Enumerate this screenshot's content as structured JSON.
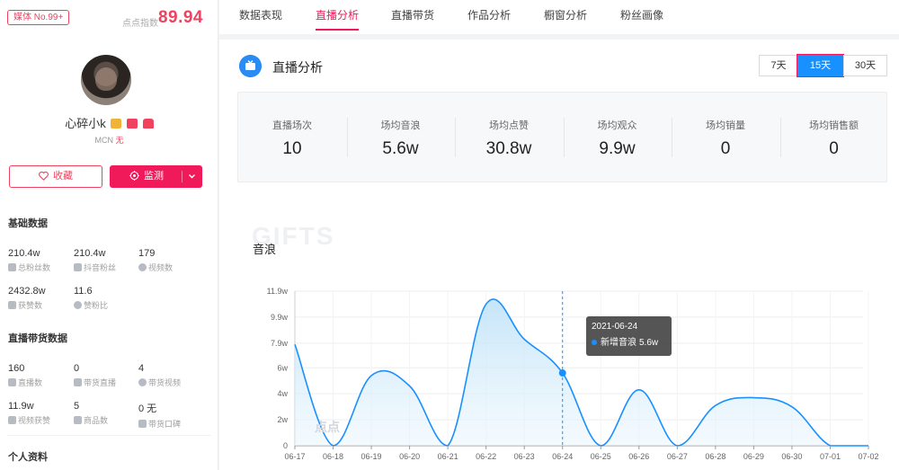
{
  "profile": {
    "badge": "媒体 No.99+",
    "score_label": "点点指数",
    "score": "89.94",
    "name": "心碎小k",
    "mcn_label": "MCN",
    "mcn_value": "无",
    "fav_label": "收藏",
    "monitor_label": "监测"
  },
  "basic": {
    "title": "基础数据",
    "stats": [
      {
        "value": "210.4w",
        "label": "总粉丝数",
        "icon": "fans-icon"
      },
      {
        "value": "210.4w",
        "label": "抖音粉丝",
        "icon": "douyin-icon"
      },
      {
        "value": "179",
        "label": "视频数",
        "icon": "video-icon"
      },
      {
        "value": "2432.8w",
        "label": "获赞数",
        "icon": "heart-icon"
      },
      {
        "value": "11.6",
        "label": "赞粉比",
        "icon": "pie-icon"
      }
    ]
  },
  "live_goods": {
    "title": "直播带货数据",
    "stats": [
      {
        "value": "160",
        "label": "直播数",
        "icon": "live-icon"
      },
      {
        "value": "0",
        "label": "带货直播",
        "icon": "cart-icon"
      },
      {
        "value": "4",
        "label": "带货视频",
        "icon": "play-icon"
      },
      {
        "value": "11.9w",
        "label": "视频获赞",
        "icon": "heart-icon"
      },
      {
        "value": "5",
        "label": "商品数",
        "icon": "goods-icon"
      },
      {
        "value": "0 无",
        "label": "带货口碑",
        "icon": "star-icon"
      }
    ]
  },
  "personal": {
    "title": "个人资料"
  },
  "tabs": [
    "数据表现",
    "直播分析",
    "直播带货",
    "作品分析",
    "橱窗分析",
    "粉丝画像"
  ],
  "section": {
    "title": "直播分析",
    "ranges": [
      "7天",
      "15天",
      "30天"
    ],
    "active_range": "15天"
  },
  "metrics": [
    {
      "label": "直播场次",
      "value": "10"
    },
    {
      "label": "场均音浪",
      "value": "5.6w"
    },
    {
      "label": "场均点赞",
      "value": "30.8w"
    },
    {
      "label": "场均观众",
      "value": "9.9w"
    },
    {
      "label": "场均销量",
      "value": "0"
    },
    {
      "label": "场均销售额",
      "value": "0"
    }
  ],
  "chart_watermark": "GIFTS",
  "watermark_logo": "点点",
  "tooltip": {
    "date": "2021-06-24",
    "series": "新增音浪",
    "value": "5.6w"
  },
  "colors": {
    "accent": "#f0195a",
    "blue": "#1890ff",
    "area": "#d6ecfb"
  },
  "chart_data": {
    "type": "area",
    "title": "音浪",
    "categories": [
      "06-17",
      "06-18",
      "06-19",
      "06-20",
      "06-21",
      "06-22",
      "06-23",
      "06-24",
      "06-25",
      "06-26",
      "06-27",
      "06-28",
      "06-29",
      "06-30",
      "07-01",
      "07-02"
    ],
    "y_ticks": [
      "0",
      "2w",
      "4w",
      "6w",
      "7.9w",
      "9.9w",
      "11.9w"
    ],
    "ylim": [
      0,
      11.9
    ],
    "series": [
      {
        "name": "新增音浪",
        "values": [
          7.8,
          0,
          5.4,
          4.6,
          0,
          10.9,
          8.2,
          5.6,
          0,
          4.3,
          0,
          3.1,
          3.7,
          3.0,
          0,
          0
        ]
      }
    ],
    "highlight_index": 7
  }
}
